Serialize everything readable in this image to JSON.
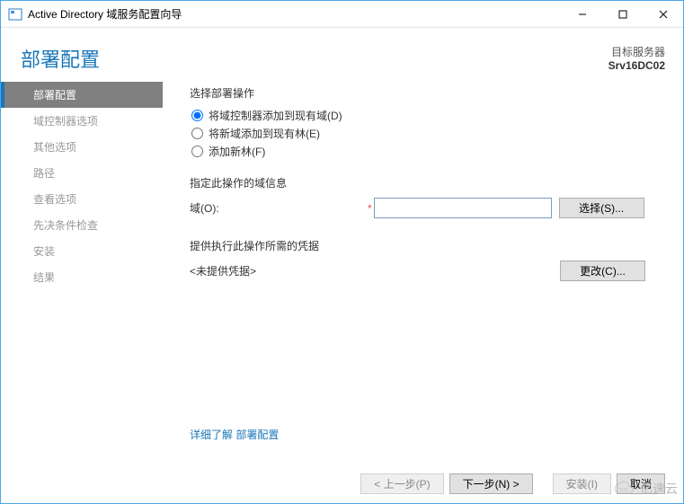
{
  "window": {
    "title": "Active Directory 域服务配置向导"
  },
  "header": {
    "page_title": "部署配置",
    "target_label": "目标服务器",
    "target_name": "Srv16DC02"
  },
  "sidebar": {
    "items": [
      {
        "label": "部署配置",
        "active": true
      },
      {
        "label": "域控制器选项",
        "active": false
      },
      {
        "label": "其他选项",
        "active": false
      },
      {
        "label": "路径",
        "active": false
      },
      {
        "label": "查看选项",
        "active": false
      },
      {
        "label": "先决条件检查",
        "active": false
      },
      {
        "label": "安装",
        "active": false
      },
      {
        "label": "结果",
        "active": false
      }
    ]
  },
  "content": {
    "operation_label": "选择部署操作",
    "radios": [
      {
        "label": "将域控制器添加到现有域(D)",
        "checked": true
      },
      {
        "label": "将新域添加到现有林(E)",
        "checked": false
      },
      {
        "label": "添加新林(F)",
        "checked": false
      }
    ],
    "domain_info_label": "指定此操作的域信息",
    "domain_field_label": "域(O):",
    "domain_value": "",
    "select_button": "选择(S)...",
    "credentials_label": "提供执行此操作所需的凭据",
    "credentials_status": "<未提供凭据>",
    "change_button": "更改(C)...",
    "more_link": "详细了解 部署配置"
  },
  "footer": {
    "prev": "< 上一步(P)",
    "next": "下一步(N) >",
    "install": "安装(I)",
    "cancel": "取消"
  },
  "watermark": {
    "text": "亿速云"
  }
}
